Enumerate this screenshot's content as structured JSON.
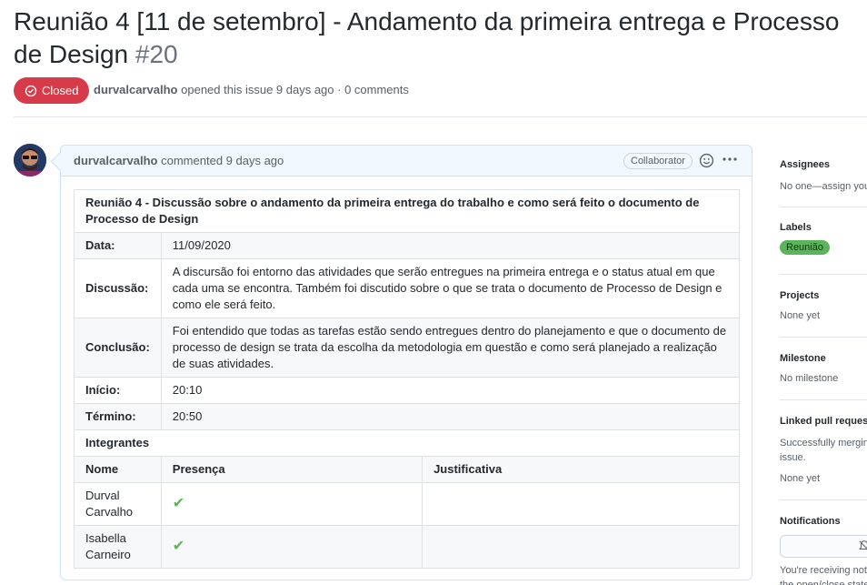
{
  "issue": {
    "title": "Reunião 4 [11 de setembro] - Andamento da primeira entrega e Processo de Design",
    "number": "#20",
    "state": "Closed",
    "author": "durvalcarvalho",
    "meta_text": "opened this issue 9 days ago · 0 comments"
  },
  "comment": {
    "author": "durvalcarvalho",
    "meta_text": "commented 9 days ago",
    "badge": "Collaborator",
    "table": {
      "title": "Reunião 4 - Discussão sobre o andamento da primeira entrega do trabalho e como será feito o documento de Processo de Design",
      "rows": [
        {
          "label": "Data:",
          "value": "11/09/2020"
        },
        {
          "label": "Discussão:",
          "value": "A discursão foi entorno das atividades que serão entregues na primeira entrega e o status atual em que cada uma se encontra. Também foi discutido sobre o que se trata o documento de Processo de Design e como ele será feito."
        },
        {
          "label": "Conclusão:",
          "value": "Foi entendido que todas as tarefas estão sendo entregues dentro do planejamento e que o documento de processo de design se trata da escolha da metodologia em questão e como será planejado a realização de suas atividades."
        },
        {
          "label": "Início:",
          "value": "20:10"
        },
        {
          "label": "Término:",
          "value": "20:50"
        }
      ],
      "members_heading": "Integrantes",
      "member_columns": [
        "Nome",
        "Presença",
        "Justificativa"
      ],
      "members": [
        {
          "name": "Durval Carvalho",
          "presence": "✔",
          "justification": ""
        },
        {
          "name": "Isabella Carneiro",
          "presence": "✔",
          "justification": ""
        }
      ]
    }
  },
  "sidebar": {
    "assignees": {
      "heading": "Assignees",
      "text": "No one—assign you"
    },
    "labels": {
      "heading": "Labels",
      "label": "Reunião",
      "label_color": "#5ab55a"
    },
    "projects": {
      "heading": "Projects",
      "text": "None yet"
    },
    "milestone": {
      "heading": "Milestone",
      "text": "No milestone"
    },
    "linked": {
      "heading": "Linked pull reques",
      "text": "Successfully mergin",
      "text2": "issue.",
      "text3": "None yet"
    },
    "notifications": {
      "heading": "Notifications",
      "text": "You're receiving noti",
      "text2": "the open/close state"
    }
  },
  "colors": {
    "closed": "#d73a49",
    "accent_border": "#c8e1ff",
    "header_bg": "#f1f8ff"
  }
}
